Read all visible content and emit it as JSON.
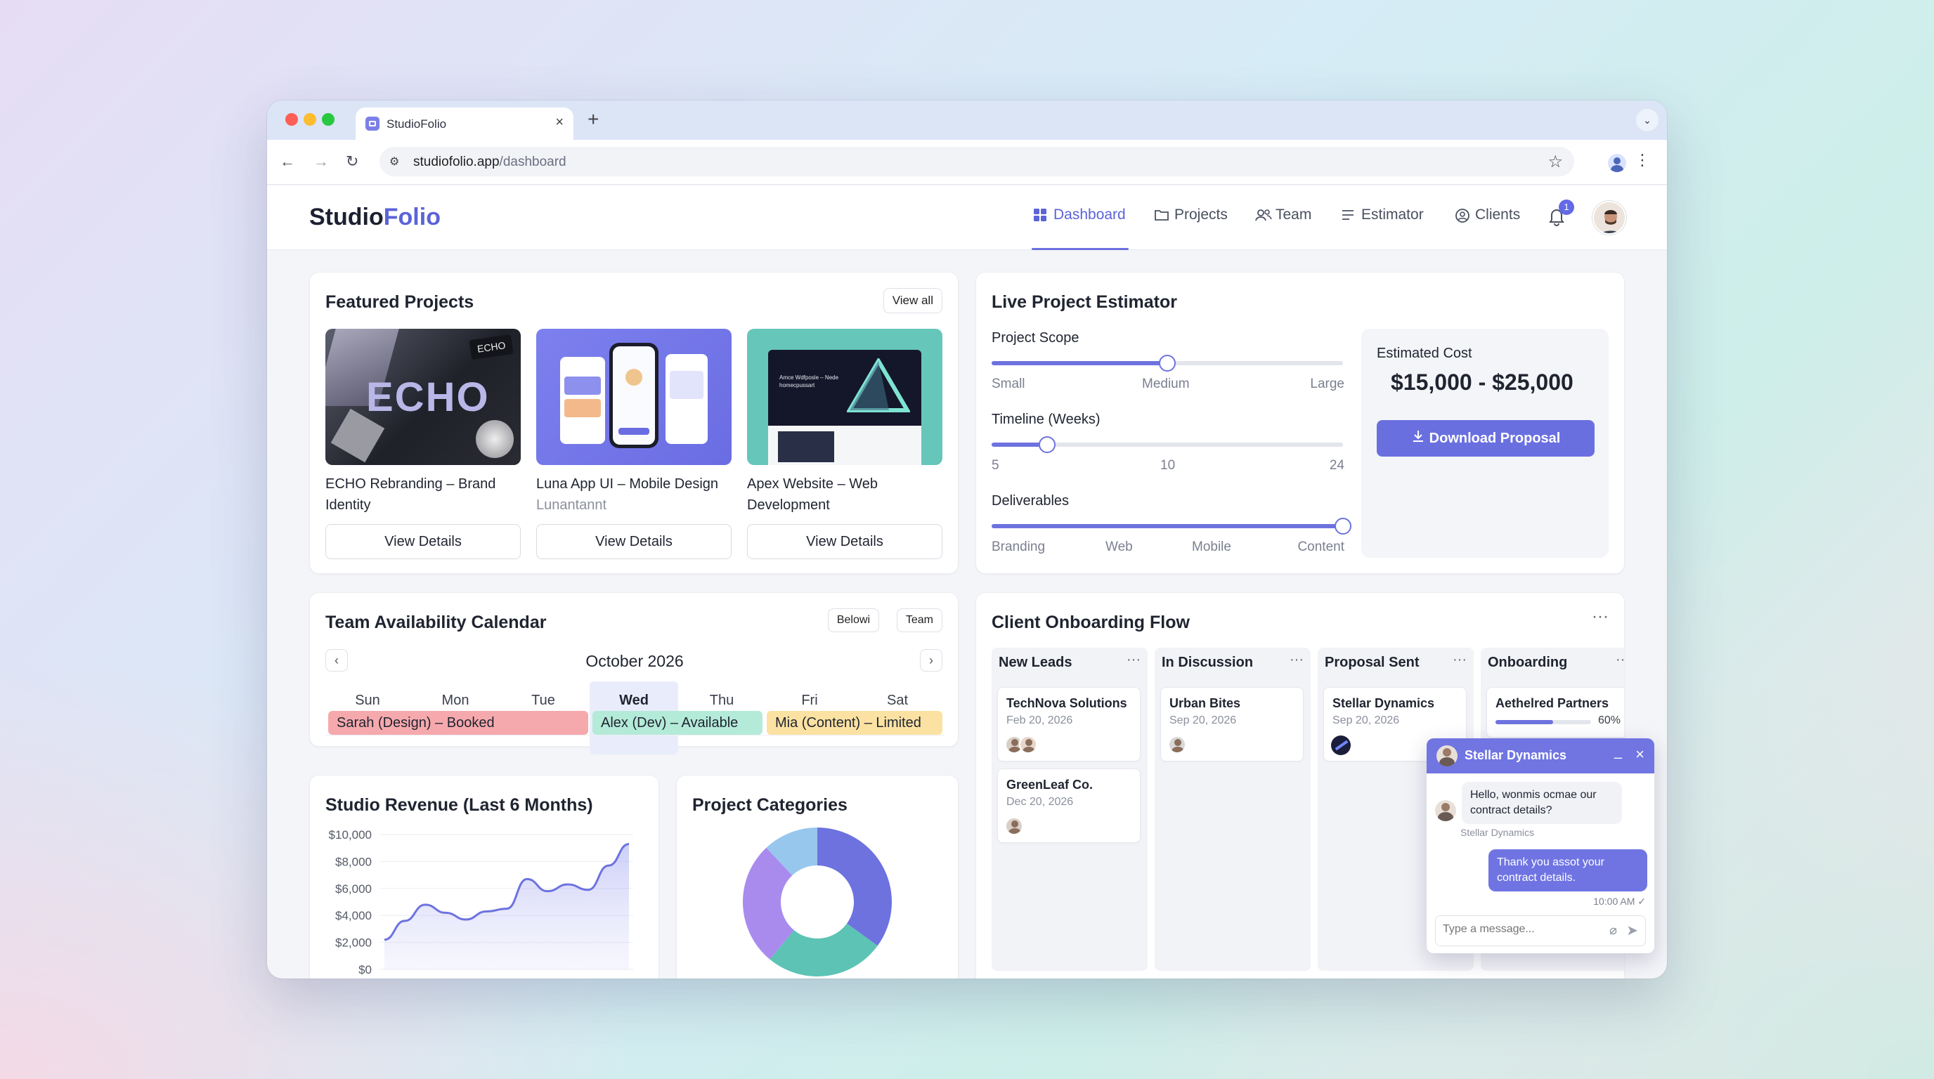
{
  "browser": {
    "tab_title": "StudioFolio",
    "url_host": "studiofolio.app",
    "url_path": "/dashboard"
  },
  "app": {
    "logo_part1": "Studio",
    "logo_part2": "Folio",
    "nav": [
      "Dashboard",
      "Projects",
      "Team",
      "Estimator",
      "Clients"
    ],
    "notification_count": "1"
  },
  "featured": {
    "title": "Featured Projects",
    "view_all": "View all",
    "projects": [
      {
        "name": "ECHO Rebranding – Brand Identity",
        "sub": "",
        "button": "View Details",
        "thumb_text": "ECHO",
        "thumb_tag": "ECHO"
      },
      {
        "name": "Luna App UI – Mobile Design",
        "sub": "Lunantannt",
        "button": "View Details"
      },
      {
        "name": "Apex Website – Web Development",
        "sub": "",
        "button": "View Details",
        "thumb_text": "Amce Wdfposle – Nede homecpussart"
      }
    ]
  },
  "estimator": {
    "title": "Live Project Estimator",
    "scope_label": "Project Scope",
    "scope_ticks": [
      "Small",
      "Medium",
      "Large"
    ],
    "scope_value": 0.5,
    "timeline_label": "Timeline (Weeks)",
    "timeline_ticks": [
      "5",
      "10",
      "24"
    ],
    "timeline_value": 8,
    "timeline_range": [
      5,
      24
    ],
    "deliverables_label": "Deliverables",
    "deliverables_ticks": [
      "Branding",
      "Web",
      "Mobile",
      "Content"
    ],
    "deliverables_value": 1.0,
    "cost_label": "Estimated Cost",
    "cost_value": "$15,000 - $25,000",
    "download": "Download Proposal"
  },
  "calendar": {
    "title": "Team Availability Calendar",
    "filters": [
      "Belowi",
      "Team"
    ],
    "month": "October 2026",
    "days": [
      "Sun",
      "Mon",
      "Tue",
      "Wed",
      "Thu",
      "Fri",
      "Sat"
    ],
    "selected_day": "Wed",
    "bookings": [
      {
        "text": "Sarah (Design) – Booked",
        "color": "#f6a9ad"
      },
      {
        "text": "Alex (Dev) – Available",
        "color": "#b4ead8"
      },
      {
        "text": "Mia (Content) – Limited",
        "color": "#fbe2a2"
      }
    ]
  },
  "revenue": {
    "title": "Studio Revenue (Last 6 Months)",
    "y_ticks": [
      "$10,000",
      "$8,000",
      "$6,000",
      "$4,000",
      "$2,000",
      "$0"
    ]
  },
  "categories": {
    "title": "Project Categories"
  },
  "chart_data": [
    {
      "type": "area",
      "title": "Studio Revenue (Last 6 Months)",
      "x": [
        0,
        1,
        2,
        3,
        4,
        5,
        6,
        7,
        8,
        9,
        10,
        11,
        12
      ],
      "values": [
        2200,
        3600,
        4800,
        4200,
        3700,
        4300,
        4500,
        6700,
        5800,
        6300,
        5900,
        7700,
        9300
      ],
      "ylim": [
        0,
        10000
      ],
      "y_ticks": [
        "$10,000",
        "$8,000",
        "$6,000",
        "$4,000",
        "$2,000",
        "$0"
      ],
      "grid": true
    },
    {
      "type": "pie",
      "title": "Project Categories",
      "values": [
        35,
        26,
        27,
        12
      ],
      "colors": [
        "#6d72df",
        "#5cc3b5",
        "#a98bee",
        "#98c7ee"
      ]
    }
  ],
  "onboarding": {
    "title": "Client Onboarding Flow",
    "columns": [
      {
        "name": "New Leads",
        "cards": [
          {
            "name": "TechNova Solutions",
            "date": "Feb 20, 2026"
          },
          {
            "name": "GreenLeaf Co.",
            "date": "Dec 20, 2026"
          }
        ]
      },
      {
        "name": "In Discussion",
        "cards": [
          {
            "name": "Urban Bites",
            "date": "Sep 20, 2026"
          }
        ]
      },
      {
        "name": "Proposal Sent",
        "cards": [
          {
            "name": "Stellar Dynamics",
            "date": "Sep 20, 2026"
          }
        ]
      },
      {
        "name": "Onboarding",
        "cards": [
          {
            "name": "Aethelred Partners",
            "progress_text": "60%",
            "progress": 0.6
          }
        ]
      }
    ]
  },
  "chat": {
    "contact": "Stellar Dynamics",
    "incoming": "Hello, wonmis ocmae our contract details?",
    "incoming_sender": "Stellar Dynamics",
    "outgoing": "Thank you assot your contract details.",
    "time": "10:00 AM",
    "placeholder": "Type a message..."
  },
  "colors": {
    "accent": "#6a6fe0",
    "text": "#1f2430",
    "muted": "#8a8f9c"
  }
}
